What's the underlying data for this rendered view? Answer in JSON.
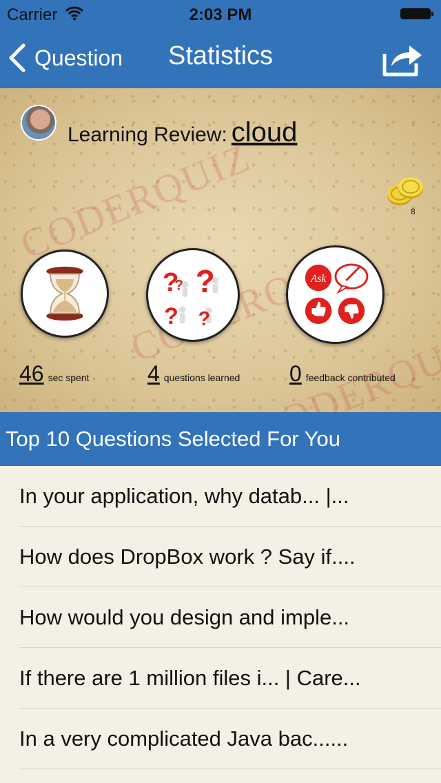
{
  "status_bar": {
    "carrier": "Carrier",
    "time": "2:03 PM"
  },
  "nav": {
    "back_label": "Question",
    "title": "Statistics"
  },
  "review": {
    "prefix": "Learning Review:",
    "topic": "cloud"
  },
  "coins": {
    "count": "8"
  },
  "watermark": "CODERQUIZ",
  "stats": {
    "time": {
      "value": "46",
      "label": "sec spent"
    },
    "learned": {
      "value": "4",
      "label": "questions learned"
    },
    "feedback": {
      "value": "0",
      "label": "feedback contributed",
      "ask_text": "Ask"
    }
  },
  "section": {
    "title": "Top 10 Questions Selected For You"
  },
  "questions": [
    "In your application, why datab... |...",
    "How does DropBox work ? Say if....",
    "How would you design and imple...",
    "If there are 1 million files i... | Care...",
    "In a very complicated Java bac......"
  ],
  "colors": {
    "brand_blue": "#3273ba",
    "list_bg": "#f3f0e6",
    "icon_red": "#e0201c"
  }
}
